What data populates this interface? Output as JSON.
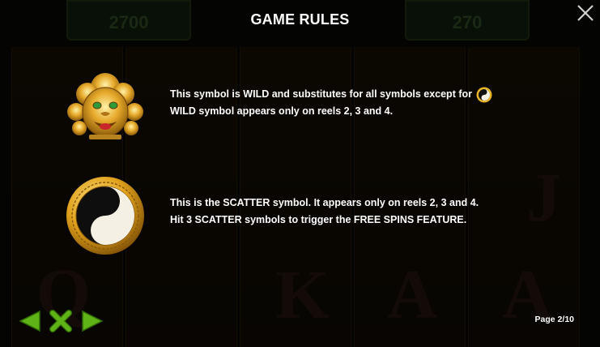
{
  "header": {
    "title": "GAME RULES",
    "left_value": "2700",
    "right_value": "270"
  },
  "rules": [
    {
      "symbol": "wild-lion-icon",
      "line1": "This symbol is WILD and substitutes for all symbols except for",
      "line2": "WILD symbol appears only on reels 2, 3 and 4."
    },
    {
      "symbol": "scatter-yin-yang-icon",
      "line1": "This is the SCATTER symbol. It appears only on reels 2, 3 and 4.",
      "line2": "Hit 3 SCATTER symbols to trigger the FREE SPINS FEATURE."
    }
  ],
  "pagination": {
    "label": "Page 2/10"
  },
  "colors": {
    "nav_green": "#5fb317",
    "gold": "#e8b428",
    "text": "#ffffff"
  }
}
